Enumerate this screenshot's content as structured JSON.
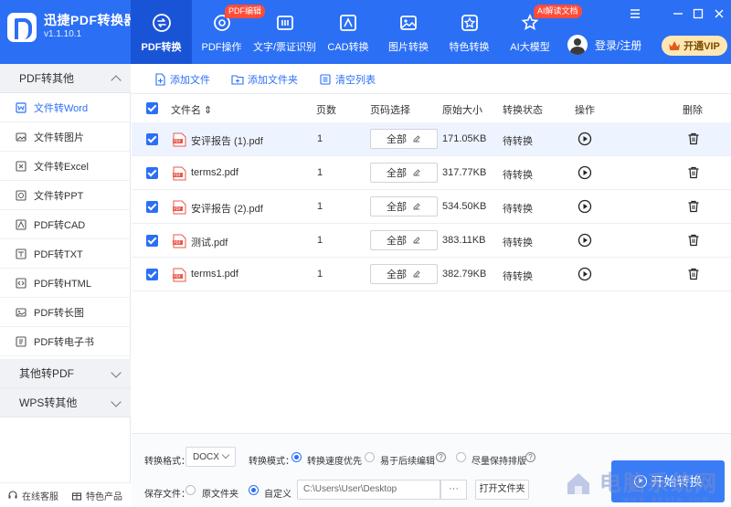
{
  "app": {
    "name": "迅捷PDF转换器",
    "version": "v1.1.10.1"
  },
  "nav": {
    "tabs": [
      {
        "label": "PDF转换",
        "active": true,
        "icon": "pdf-convert-icon"
      },
      {
        "label": "PDF操作",
        "active": false,
        "icon": "pdf-operate-icon",
        "tag": "PDF编辑"
      },
      {
        "label": "文字/票证识别",
        "active": false,
        "icon": "ocr-icon"
      },
      {
        "label": "CAD转换",
        "active": false,
        "icon": "cad-icon"
      },
      {
        "label": "图片转换",
        "active": false,
        "icon": "image-icon"
      },
      {
        "label": "特色转换",
        "active": false,
        "icon": "special-icon"
      },
      {
        "label": "AI大模型",
        "active": false,
        "icon": "ai-icon",
        "tag": "AI解读文档"
      }
    ],
    "user_label": "登录/注册",
    "vip_label": "开通VIP"
  },
  "sidebar": {
    "groups": [
      {
        "label": "PDF转其他",
        "expanded": true
      },
      {
        "label": "其他转PDF",
        "expanded": false
      },
      {
        "label": "WPS转其他",
        "expanded": false
      }
    ],
    "items": [
      {
        "label": "文件转Word",
        "active": true,
        "icon": "word-icon"
      },
      {
        "label": "文件转图片",
        "active": false,
        "icon": "image-icon"
      },
      {
        "label": "文件转Excel",
        "active": false,
        "icon": "excel-icon"
      },
      {
        "label": "文件转PPT",
        "active": false,
        "icon": "ppt-icon"
      },
      {
        "label": "PDF转CAD",
        "active": false,
        "icon": "cad-icon"
      },
      {
        "label": "PDF转TXT",
        "active": false,
        "icon": "txt-icon"
      },
      {
        "label": "PDF转HTML",
        "active": false,
        "icon": "html-icon"
      },
      {
        "label": "PDF转长图",
        "active": false,
        "icon": "long-image-icon"
      },
      {
        "label": "PDF转电子书",
        "active": false,
        "icon": "ebook-icon"
      }
    ],
    "footer": {
      "support": "在线客服",
      "products": "特色产品"
    }
  },
  "toolbar": {
    "add_file": "添加文件",
    "add_folder": "添加文件夹",
    "clear_list": "清空列表"
  },
  "table": {
    "headers": {
      "name": "文件名 ⇕",
      "pages": "页数",
      "page_select": "页码选择",
      "size": "原始大小",
      "status": "转换状态",
      "action": "操作",
      "delete": "删除"
    },
    "rows": [
      {
        "name": "安评报告 (1).pdf",
        "pages": "1",
        "page_select": "全部",
        "size": "171.05KB",
        "status": "待转换",
        "selected": true
      },
      {
        "name": "terms2.pdf",
        "pages": "1",
        "page_select": "全部",
        "size": "317.77KB",
        "status": "待转换",
        "selected": false
      },
      {
        "name": "安评报告 (2).pdf",
        "pages": "1",
        "page_select": "全部",
        "size": "534.50KB",
        "status": "待转换",
        "selected": false
      },
      {
        "name": "测试.pdf",
        "pages": "1",
        "page_select": "全部",
        "size": "383.11KB",
        "status": "待转换",
        "selected": false
      },
      {
        "name": "terms1.pdf",
        "pages": "1",
        "page_select": "全部",
        "size": "382.79KB",
        "status": "待转换",
        "selected": false
      }
    ]
  },
  "bottom": {
    "format_label": "转换格式：",
    "format_value": "DOCX",
    "mode_label": "转换模式：",
    "mode_options": [
      "转换速度优先",
      "易于后续编辑",
      "尽量保持排版"
    ],
    "mode_selected": 0,
    "save_label": "保存文件：",
    "save_options": [
      "原文件夹",
      "自定义"
    ],
    "save_selected": 1,
    "save_path": "C:\\Users\\User\\Desktop",
    "browse": "···",
    "open_folder": "打开文件夹",
    "start": "开始转换"
  },
  "watermark": {
    "text": "电脑系统网",
    "sub": "www.dnxtw.com"
  },
  "colors": {
    "brand": "#2b6ff5",
    "active_tab": "#1a54d6",
    "tag": "#ff4d3a",
    "vip": "#ffe7b3"
  }
}
